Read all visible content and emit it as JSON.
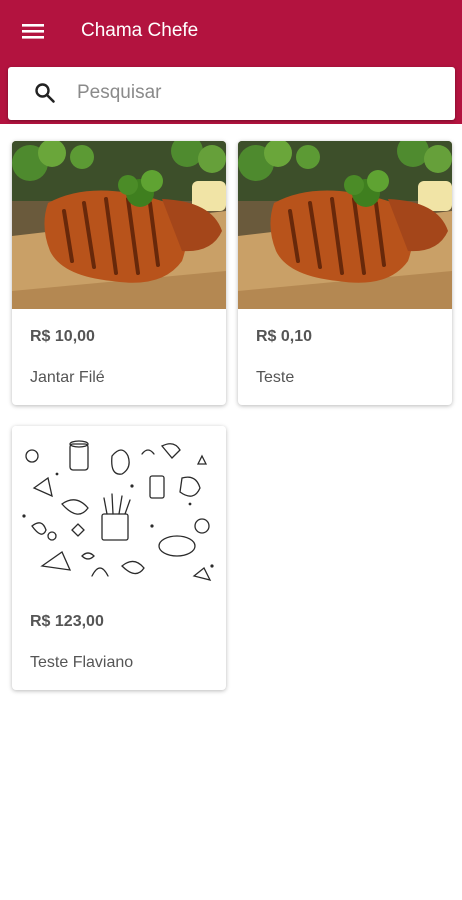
{
  "app": {
    "title": "Chama Chefe",
    "menu_icon": "hamburger-menu-icon",
    "primary_color": "#b3133f"
  },
  "search": {
    "placeholder": "Pesquisar",
    "value": "",
    "icon": "search-icon"
  },
  "products": [
    {
      "price": "R$ 10,00",
      "name": "Jantar Filé",
      "image": "grilled-chicken-photo"
    },
    {
      "price": "R$ 0,10",
      "name": "Teste",
      "image": "grilled-chicken-photo"
    },
    {
      "price": "R$ 123,00",
      "name": "Teste Flaviano",
      "image": "food-doodle-illustration"
    }
  ]
}
